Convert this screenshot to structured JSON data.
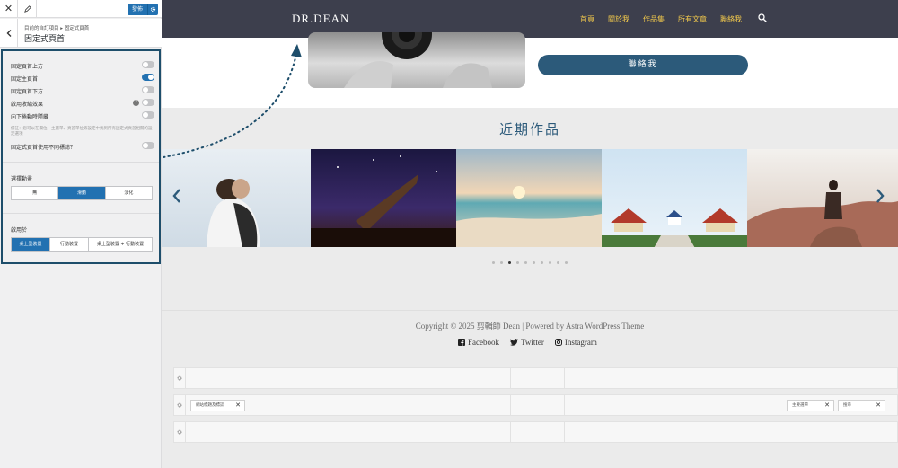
{
  "customizer": {
    "toolbar": {
      "publish_label": "發佈"
    },
    "section": {
      "breadcrumb": "目前的自訂項目 ▸ 固定式頁首",
      "title": "固定式頁首"
    },
    "toggles": [
      {
        "label": "固定頁首上方",
        "on": false
      },
      {
        "label": "固定主頁首",
        "on": true
      },
      {
        "label": "固定頁首下方",
        "on": false
      },
      {
        "label": "啟用收縮效果",
        "on": false,
        "help": "?"
      },
      {
        "label": "向下捲動時隱藏",
        "on": false
      }
    ],
    "note": "備註：您可以在欄位、主畫單、頁首單位等設定中找到所有固定式頁首相關的設定選項",
    "different_logo": {
      "label": "固定式頁首使用不同標誌？",
      "on": false
    },
    "animation": {
      "title": "選擇動畫",
      "options": [
        "無",
        "滑動",
        "淡化"
      ],
      "selected": "滑動"
    },
    "enable_on": {
      "title": "啟用於",
      "options": [
        "桌上型裝置",
        "行動裝置",
        "桌上型裝置 + 行動裝置"
      ],
      "selected": "桌上型裝置"
    }
  },
  "site": {
    "logo": "DR.DEAN",
    "nav": [
      "首頁",
      "關於我",
      "作品集",
      "所有文章",
      "聯絡我"
    ],
    "contact_button": "聯絡我",
    "recent_title": "近期作品",
    "carousel": {
      "dot_count": 10,
      "active_index": 2
    },
    "footer": {
      "copyright": "Copyright © 2025 剪輯師 Dean | Powered by Astra WordPress Theme",
      "social": [
        {
          "icon": "facebook-icon",
          "label": "Facebook"
        },
        {
          "icon": "twitter-icon",
          "label": "Twitter"
        },
        {
          "icon": "instagram-icon",
          "label": "Instagram"
        }
      ]
    },
    "builder": {
      "middle_row": {
        "left_chip": "網站標題及標誌",
        "right_chips": [
          "主要選單",
          "搜尋"
        ]
      }
    }
  },
  "colors": {
    "accent": "#2271b1",
    "panel_border": "#1e4e6b",
    "header_bg": "#3d3f4d",
    "nav_text": "#f2c94c",
    "brand": "#2c5a7a"
  }
}
